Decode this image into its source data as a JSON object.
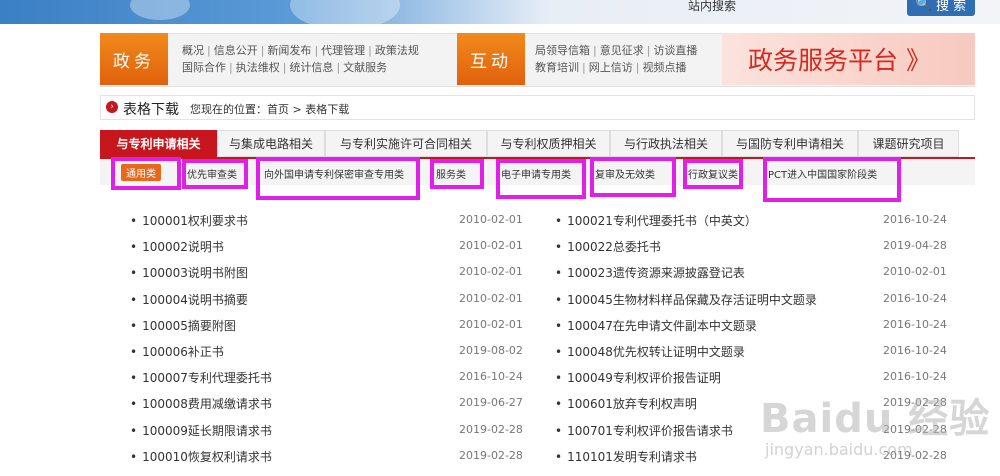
{
  "search": {
    "label": "站内搜索",
    "button": "搜 索"
  },
  "nav": {
    "gov_head": "政务",
    "gov_links_row1": [
      "概况",
      "信息公开",
      "新闻发布",
      "代理管理",
      "政策法规"
    ],
    "gov_links_row2": [
      "国际合作",
      "执法维权",
      "统计信息",
      "文献服务"
    ],
    "interact_head": "互动",
    "interact_links_row1": [
      "局领导信箱",
      "意见征求",
      "访谈直播"
    ],
    "interact_links_row2": [
      "教育培训",
      "网上信访",
      "视频点播"
    ],
    "platform": "政务服务平台 》"
  },
  "breadcrumb": {
    "title": "表格下载",
    "loc_prefix": "您现在的位置：",
    "home": "首页",
    "separator": ">",
    "current": "表格下载"
  },
  "tabs": [
    "与专利申请相关",
    "与集成电路相关",
    "与专利实施许可合同相关",
    "与专利权质押相关",
    "与行政执法相关",
    "与国防专利申请相关",
    "课题研究项目"
  ],
  "subtabs": [
    "通用类",
    "优先审查类",
    "向外国申请专利保密审查专用类",
    "服务类",
    "电子申请专用类",
    "复审及无效类",
    "行政复议类",
    "PCT进入中国国家阶段类"
  ],
  "list_left": [
    {
      "name": "100001权利要求书",
      "date": "2010-02-01"
    },
    {
      "name": "100002说明书",
      "date": "2010-02-01"
    },
    {
      "name": "100003说明书附图",
      "date": "2010-02-01"
    },
    {
      "name": "100004说明书摘要",
      "date": "2010-02-01"
    },
    {
      "name": "100005摘要附图",
      "date": "2010-02-01"
    },
    {
      "name": "100006补正书",
      "date": "2019-08-02"
    },
    {
      "name": "100007专利代理委托书",
      "date": "2016-10-24"
    },
    {
      "name": "100008费用减缴请求书",
      "date": "2019-06-27"
    },
    {
      "name": "100009延长期限请求书",
      "date": "2019-02-28"
    },
    {
      "name": "100010恢复权利请求书",
      "date": "2019-02-28"
    }
  ],
  "list_right": [
    {
      "name": "100021专利代理委托书（中英文）",
      "date": "2016-10-24"
    },
    {
      "name": "100022总委托书",
      "date": "2019-04-28"
    },
    {
      "name": "100023遗传资源来源披露登记表",
      "date": "2010-02-01"
    },
    {
      "name": "100045生物材料样品保藏及存活证明中文题录",
      "date": "2016-10-24"
    },
    {
      "name": "100047在先申请文件副本中文题录",
      "date": "2016-10-24"
    },
    {
      "name": "100048优先权转让证明中文题录",
      "date": "2016-10-24"
    },
    {
      "name": "100049专利权评价报告证明",
      "date": "2016-10-24"
    },
    {
      "name": "100601放弃专利权声明",
      "date": "2019-02-28"
    },
    {
      "name": "100701专利权评价报告请求书",
      "date": "2019-02-28"
    },
    {
      "name": "110101发明专利请求书",
      "date": "2019-02-28"
    }
  ],
  "bullet": "•",
  "watermark": {
    "main": "Baidu 经验",
    "sub": "jingyan.baidu.com"
  },
  "colors": {
    "brand_red": "#c8161e",
    "orange": "#e9671a",
    "highlight": "#e020e8",
    "blue": "#2f6db5"
  }
}
